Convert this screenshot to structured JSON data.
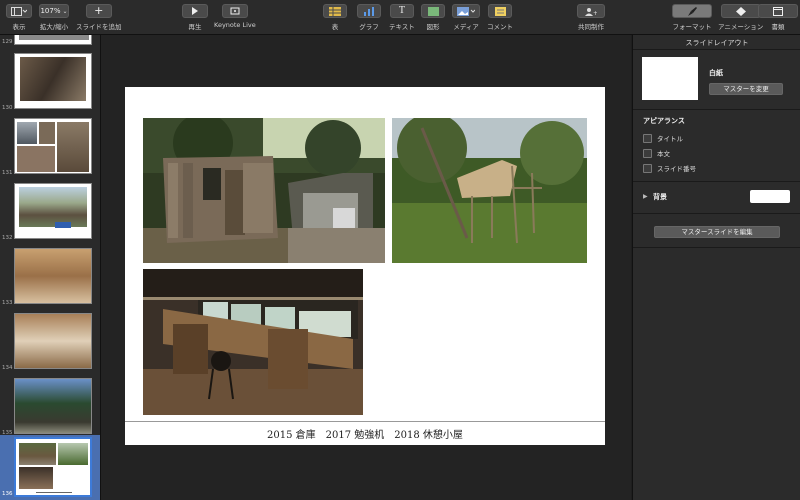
{
  "toolbar": {
    "view_label": "表示",
    "zoom_value": "107%",
    "zoom_label": "拡大/縮小",
    "add_slide_label": "スライドを追加",
    "play_label": "再生",
    "keynote_live_label": "Keynote Live",
    "table_label": "表",
    "chart_label": "グラフ",
    "text_label": "テキスト",
    "shape_label": "図形",
    "media_label": "メディア",
    "comment_label": "コメント",
    "collaborate_label": "共同制作",
    "format_label": "フォーマット",
    "animate_label": "アニメーション",
    "document_label": "書類",
    "accent_color": "#3d7bd9"
  },
  "navigator": {
    "slides": [
      {
        "number": "129"
      },
      {
        "number": "130"
      },
      {
        "number": "131"
      },
      {
        "number": "132"
      },
      {
        "number": "133"
      },
      {
        "number": "134"
      },
      {
        "number": "135"
      },
      {
        "number": "136",
        "selected": true
      }
    ]
  },
  "slide": {
    "caption": "2015 倉庫　2017 勉強机　2018 休憩小屋"
  },
  "inspector": {
    "title": "スライドレイアウト",
    "layout_name": "白紙",
    "change_master_label": "マスターを変更",
    "appearance_label": "アピアランス",
    "appearance_options": [
      {
        "label": "タイトル",
        "checked": false
      },
      {
        "label": "本文",
        "checked": false
      },
      {
        "label": "スライド番号",
        "checked": false
      }
    ],
    "background_label": "背景",
    "edit_master_label": "マスタースライドを編集"
  }
}
